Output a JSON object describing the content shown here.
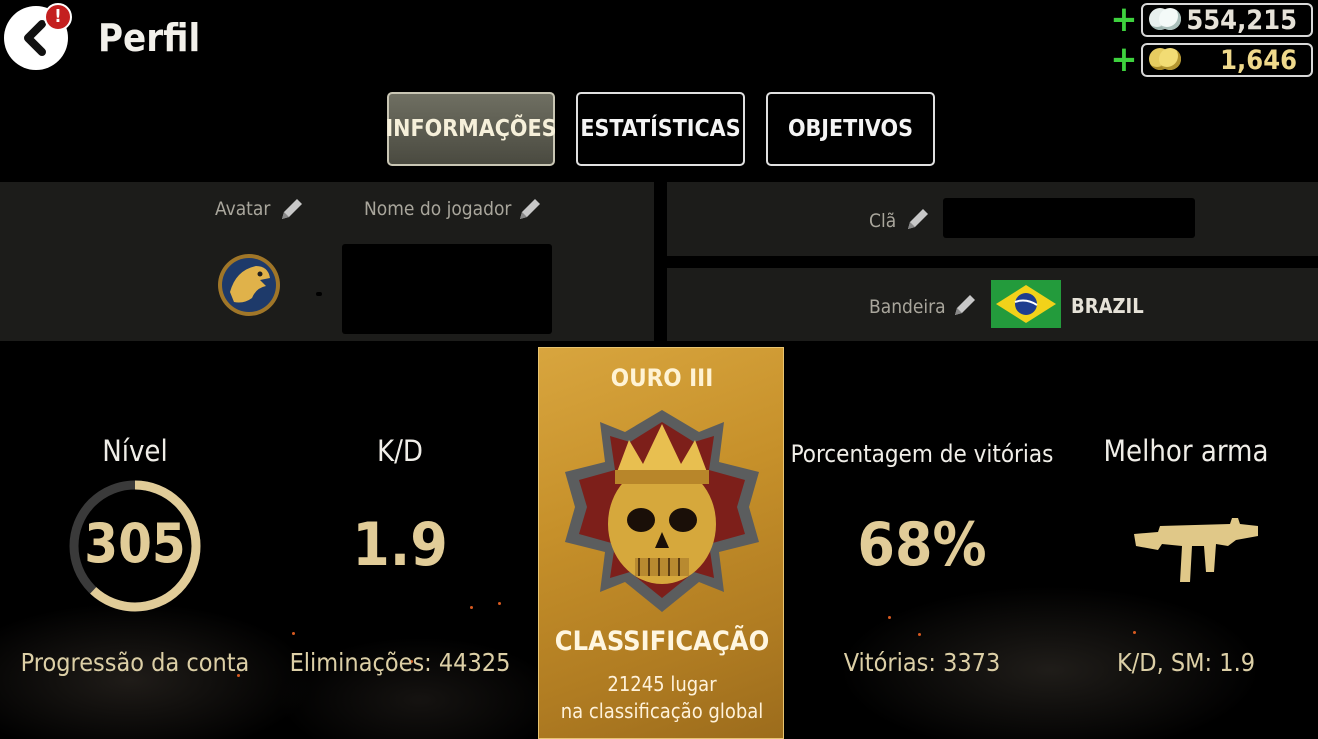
{
  "header": {
    "title": "Perfil",
    "alert_badge": "!"
  },
  "currency": {
    "silver": {
      "plus": "+",
      "amount": "554,215",
      "icon": "silver-coins-icon"
    },
    "gold": {
      "plus": "+",
      "amount": "1,646",
      "icon": "gold-coins-icon"
    }
  },
  "tabs": [
    {
      "label": "INFORMAÇÕES",
      "active": true
    },
    {
      "label": "ESTATÍSTICAS",
      "active": false
    },
    {
      "label": "OBJETIVOS",
      "active": false
    }
  ],
  "profile": {
    "avatar_label": "Avatar",
    "player_name_label": "Nome do jogador",
    "clan_label": "Clã",
    "flag_label": "Bandeira",
    "country": "BRAZIL"
  },
  "stats": {
    "level": {
      "title": "Nível",
      "value": "305",
      "footer": "Progressão da conta",
      "progress": 0.62
    },
    "kd": {
      "title": "K/D",
      "value": "1.9",
      "footer": "Eliminações: 44325"
    },
    "rank": {
      "tier": "OURO III",
      "title": "CLASSIFICAÇÃO",
      "line1": "21245 lugar",
      "line2": "na classificação global"
    },
    "win_rate": {
      "title": "Porcentagem de vitórias",
      "value": "68%",
      "footer": "Vitórias: 3373"
    },
    "best_weapon": {
      "title": "Melhor arma",
      "footer": "K/D, SM: 1.9"
    }
  },
  "colors": {
    "accent_gold": "#e1cc98",
    "plus_green": "#3ed13e",
    "rank_card": "#c6902a",
    "alert_red": "#c42020"
  }
}
